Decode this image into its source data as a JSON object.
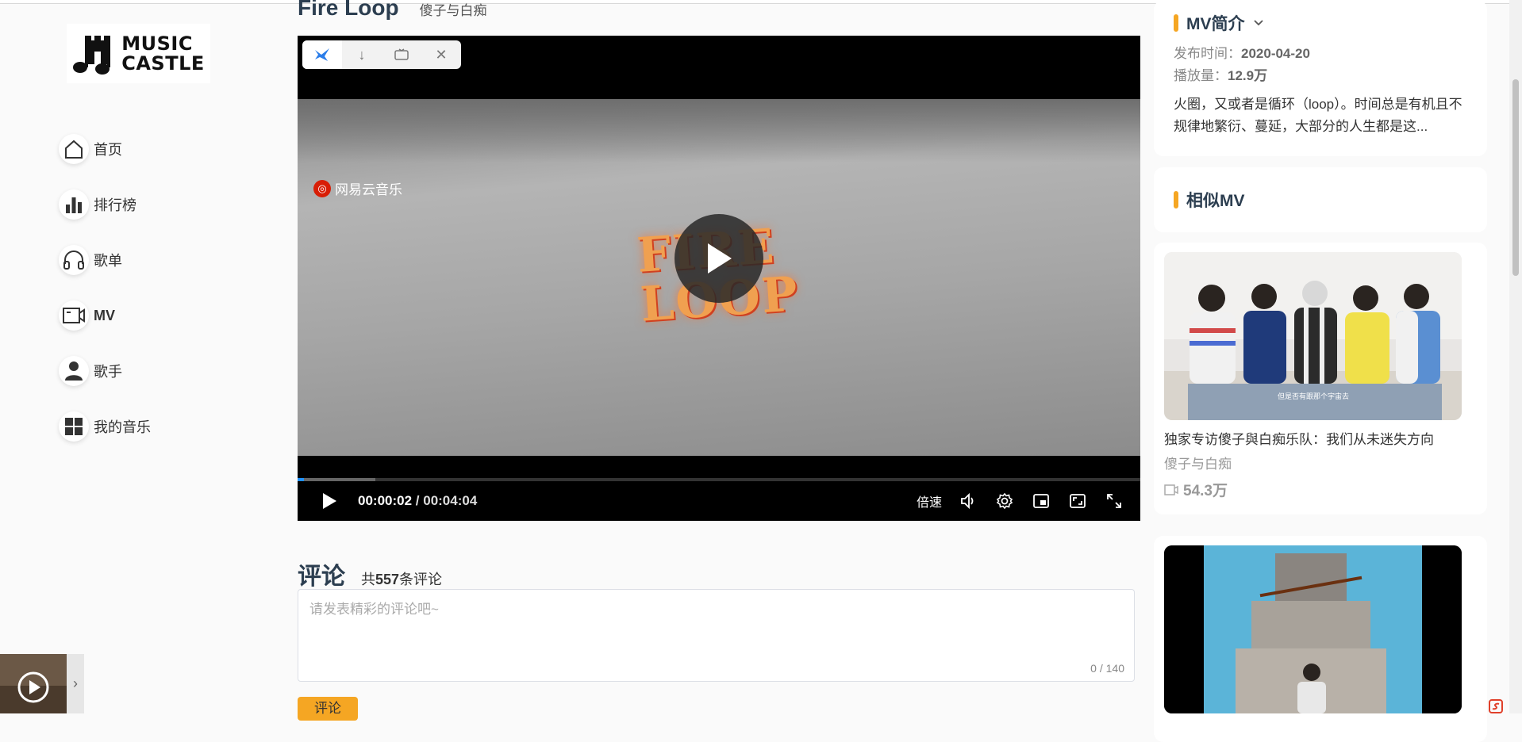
{
  "logo": {
    "line1": "MUSIC",
    "line2": "CASTLE"
  },
  "nav": [
    {
      "label": "首页",
      "icon": "home-icon"
    },
    {
      "label": "排行榜",
      "icon": "chart-bars-icon"
    },
    {
      "label": "歌单",
      "icon": "headphones-icon"
    },
    {
      "label": "MV",
      "icon": "video-camera-icon",
      "active": true
    },
    {
      "label": "歌手",
      "icon": "person-icon"
    },
    {
      "label": "我的音乐",
      "icon": "grid-icon"
    }
  ],
  "mv": {
    "title": "Fire Loop",
    "artist": "傻子与白痴"
  },
  "player": {
    "watermark": "网易云音乐",
    "overlay_text_line1": "FIRE",
    "overlay_text_line2": "LOOP",
    "current_time": "00:00:02",
    "separator": " / ",
    "duration": "00:04:04",
    "played_fraction": 0.008,
    "buffered_fraction": 0.092,
    "speed_label": "倍速"
  },
  "comments": {
    "title": "评论",
    "count_prefix": "共",
    "count": "557",
    "count_suffix": "条评论",
    "placeholder": "请发表精彩的评论吧~",
    "char_count": "0 / 140",
    "submit_label": "评论"
  },
  "intro": {
    "title": "MV简介",
    "date_label": "发布时间：",
    "date": "2020-04-20",
    "plays_label": "播放量：",
    "plays": "12.9万",
    "description": "火圈，又或者是循环（loop）。时间总是有机且不规律地繁衍、蔓延，大部分的人生都是这..."
  },
  "similar": {
    "title": "相似MV",
    "items": [
      {
        "name": "独家专访傻子與白痴乐队：我们从未迷失方向",
        "singer": "傻子与白痴",
        "plays": "54.3万",
        "caption": "但是否有跟那个宇宙去"
      },
      {
        "name": "",
        "singer": "",
        "plays": ""
      }
    ]
  },
  "colors": {
    "accent": "#f5a623",
    "title": "#2c3e50",
    "progress": "#1e90ff"
  }
}
